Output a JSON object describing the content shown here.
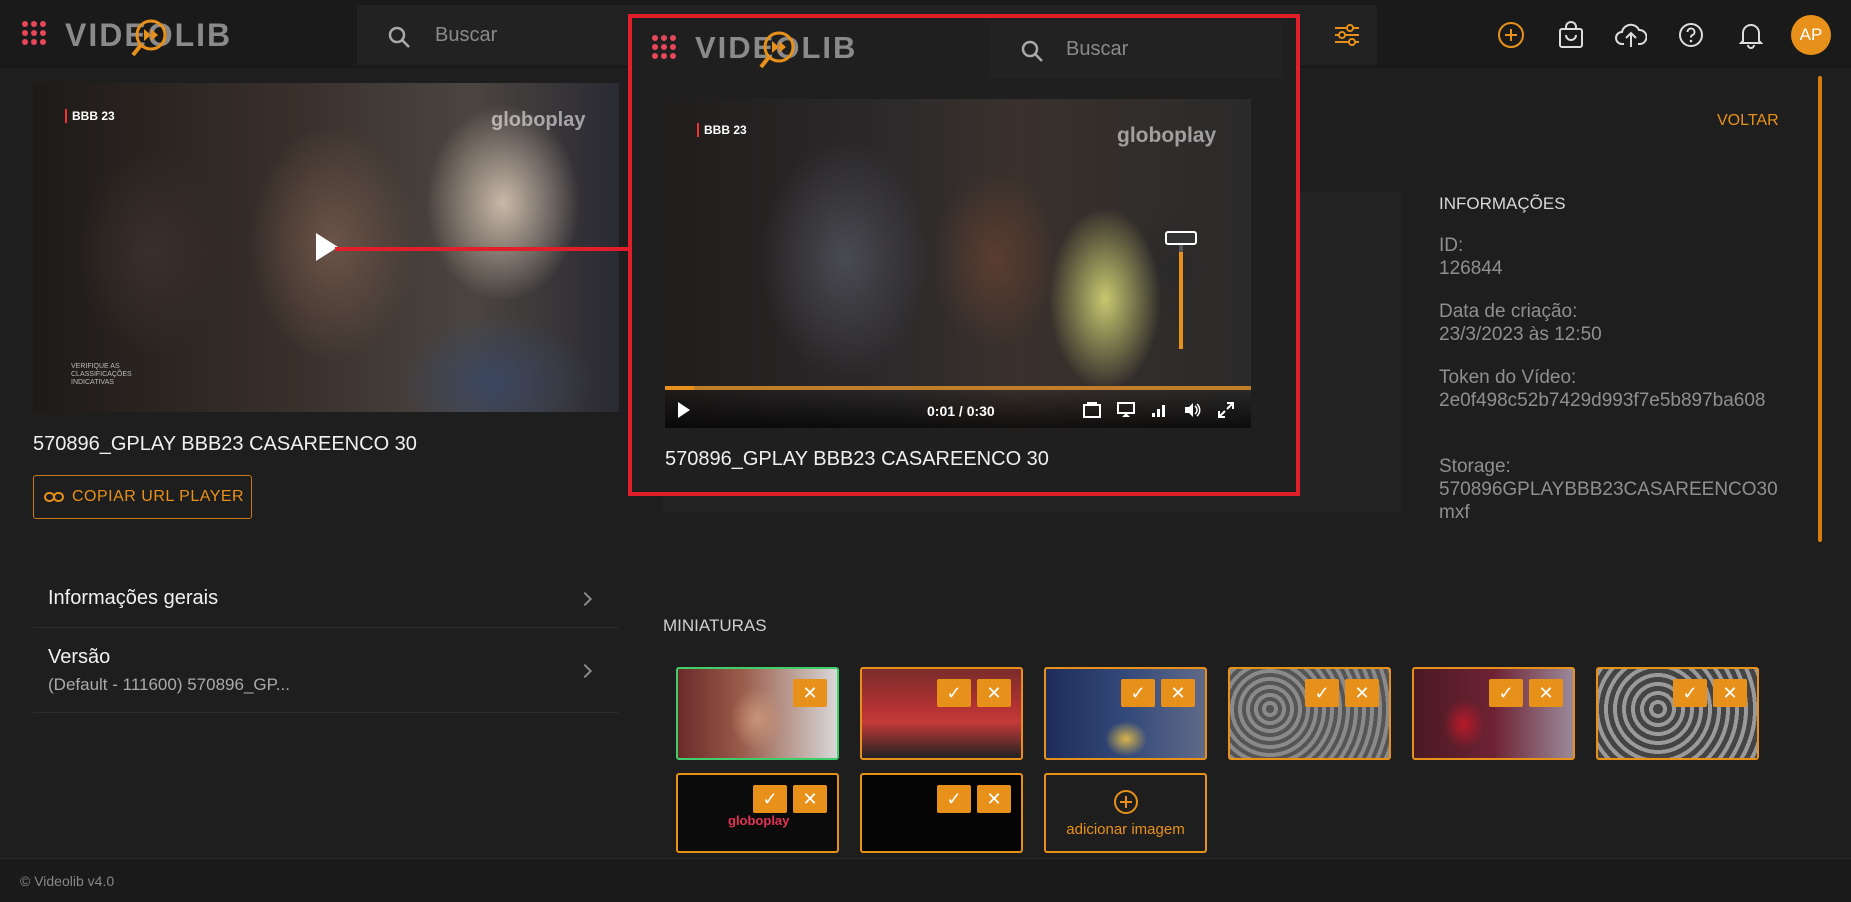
{
  "app": {
    "logo_text": "VIDEOLIB",
    "search_placeholder": "Buscar",
    "avatar_initials": "AP",
    "accent_color": "#e8911a",
    "brand_red": "#e8475a"
  },
  "header_icons": [
    "filter-sliders-icon",
    "add-circle-icon",
    "shopping-bag-icon",
    "cloud-upload-icon",
    "help-icon",
    "bell-icon"
  ],
  "video": {
    "badge": "BBB 23",
    "watermark": "globoplay",
    "rating_notice": "VERIFIQUE AS CLASSIFICAÇÕES INDICATIVAS",
    "title": "570896_GPLAY BBB23 CASAREENCO 30"
  },
  "left": {
    "copy_button": "COPIAR URL PLAYER",
    "menu": [
      {
        "label": "Informações gerais",
        "sub": ""
      },
      {
        "label": "Versão",
        "sub": "(Default - 111600) 570896_GP..."
      }
    ]
  },
  "right": {
    "back_label": "VOLTAR",
    "info_heading": "INFORMAÇÕES",
    "fields": [
      {
        "label": "ID:",
        "value": "126844"
      },
      {
        "label": "Data de criação:",
        "value": "23/3/2023 às 12:50"
      },
      {
        "label": "Token do Vídeo:",
        "value": "2e0f498c52b7429d993f7e5b897ba608"
      },
      {
        "label": "Storage:",
        "value": "570896GPLAYBBB23CASAREENCO30mxf"
      }
    ]
  },
  "thumbnails": {
    "heading": "MINIATURAS",
    "add_label": "adicionar imagem",
    "thumb2_text": "globoplay"
  },
  "player": {
    "time": "0:01 / 0:30",
    "progress": 0.05,
    "volume": 0.85
  },
  "footer": {
    "copyright": "© Videolib v4.0"
  }
}
